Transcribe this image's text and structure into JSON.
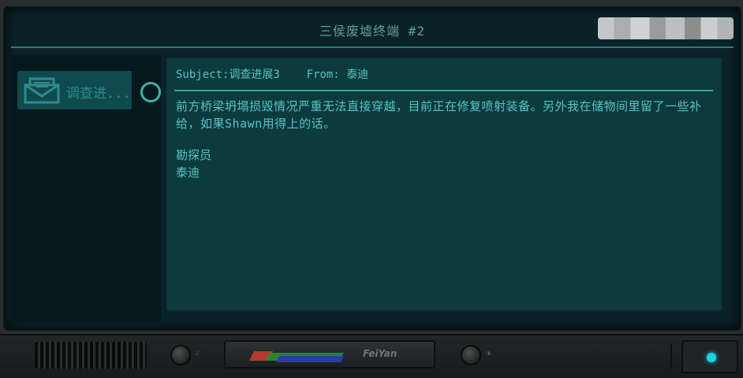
{
  "window": {
    "title": "三侯废墟终端 #2"
  },
  "inbox": {
    "items": [
      {
        "label": "调查进...",
        "icon": "envelope-icon"
      }
    ]
  },
  "message": {
    "subject_label": "Subject:",
    "subject": "调查进展3",
    "from_label": "From:",
    "from": "泰迪",
    "body": "前方桥梁坍塌损毁情况严重无法直接穿越，目前正在修复喷射装备。另外我在储物间里留了一些补给，如果Shawn用得上的话。",
    "signature_title": "勘探员",
    "signature_name": "泰迪"
  },
  "panel": {
    "brand": "FeiYan"
  },
  "colors": {
    "screen_bg": "#0b2328",
    "content_bg": "#0c3a3d",
    "accent": "#3aa3a3",
    "text": "#56c4c4",
    "led": "#19d3e3"
  }
}
